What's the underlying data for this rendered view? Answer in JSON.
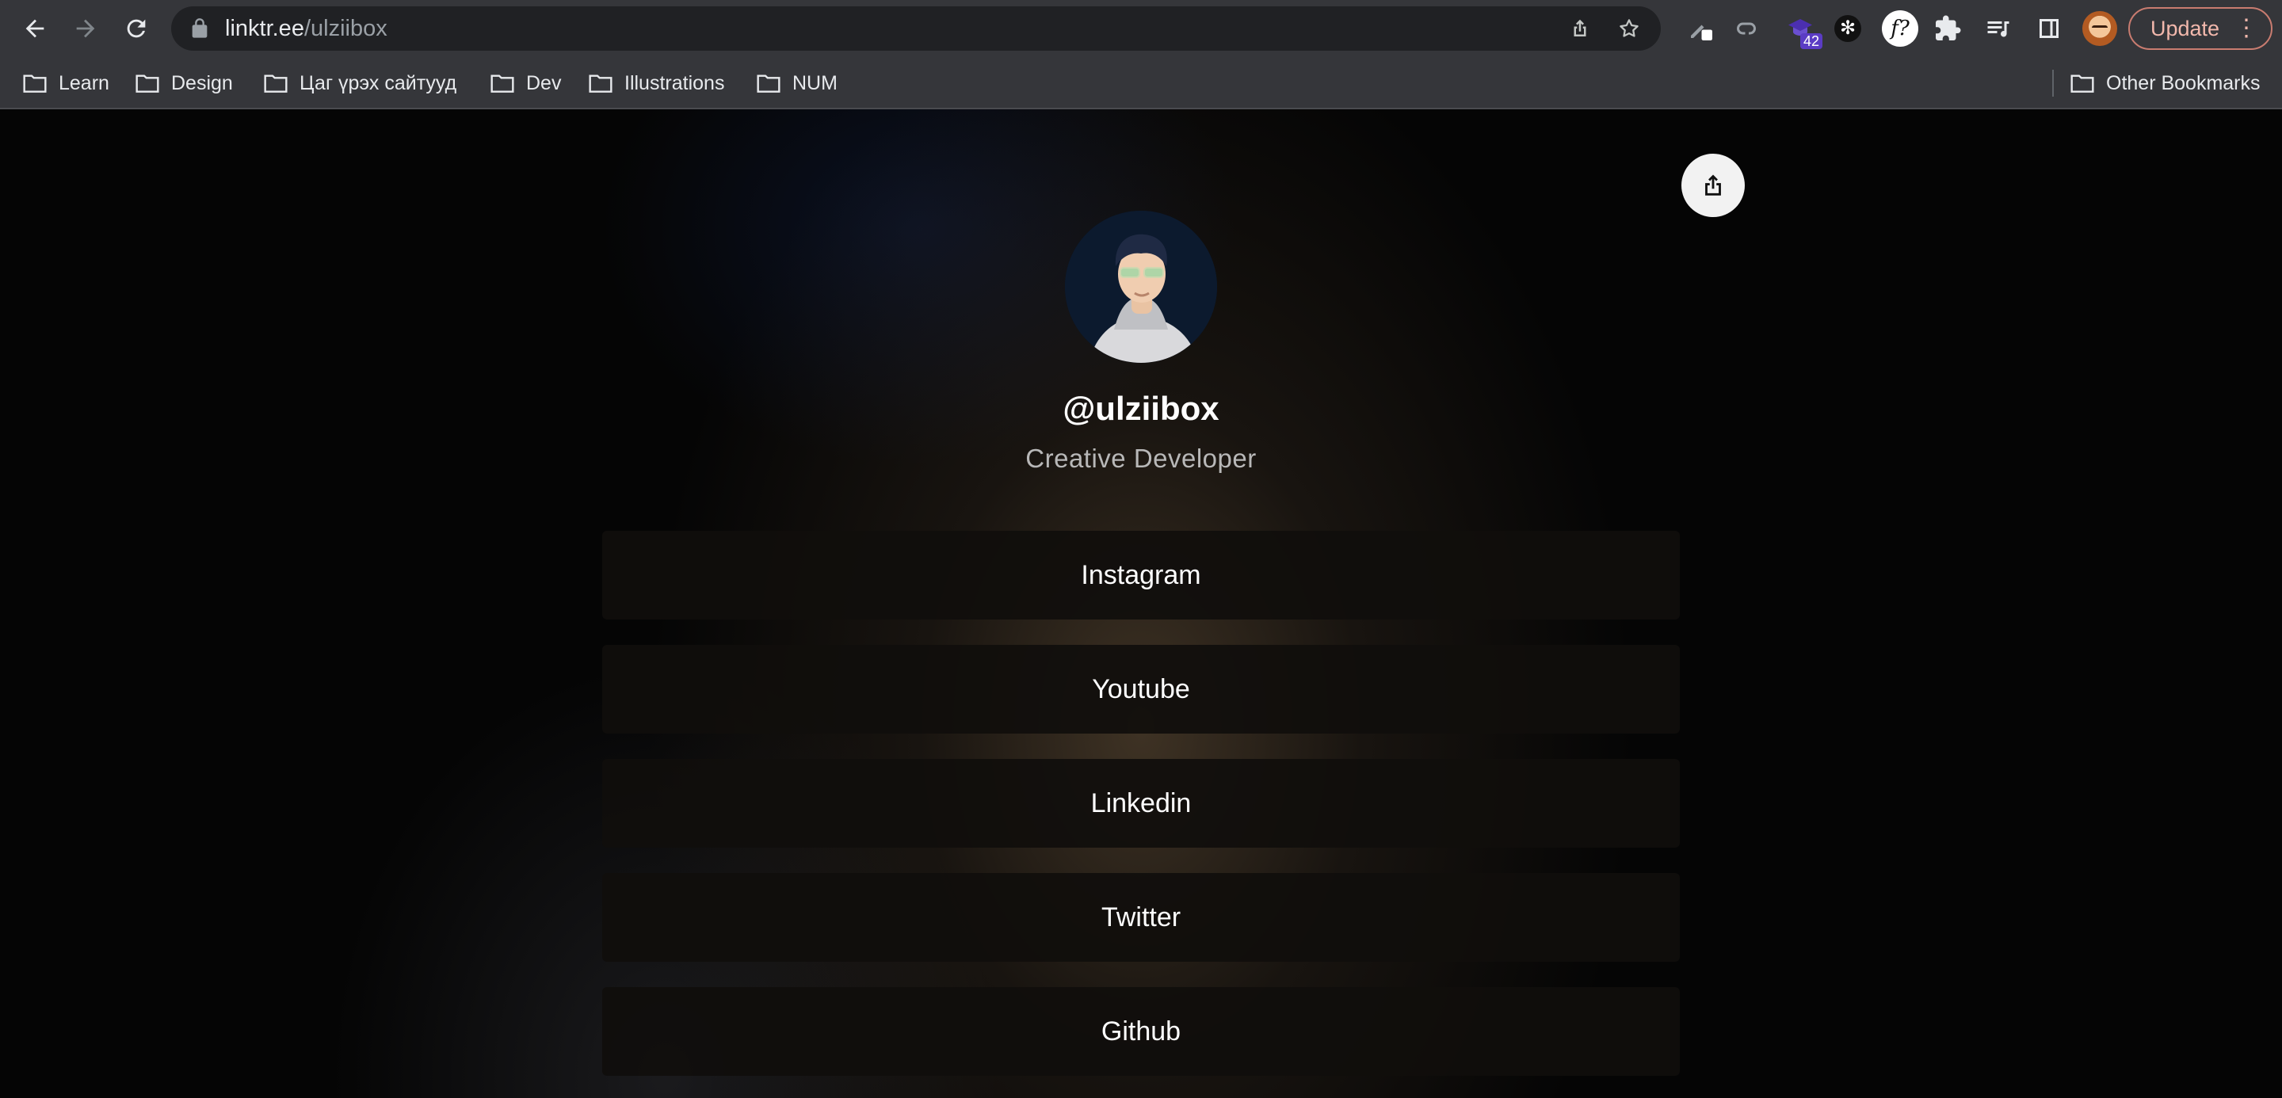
{
  "browser": {
    "url_host": "linktr.ee",
    "url_path": "/ulziibox",
    "extension_badge": "42",
    "update_label": "Update",
    "menu_dots": "⋮",
    "extension_f_label": "f?",
    "extension_asterisk": "✻"
  },
  "bookmarks": {
    "items": [
      {
        "label": "Learn"
      },
      {
        "label": "Design"
      },
      {
        "label": "Цаг үрэх сайтууд"
      },
      {
        "label": "Dev"
      },
      {
        "label": "Illustrations"
      },
      {
        "label": "NUM"
      }
    ],
    "other_label": "Other Bookmarks"
  },
  "profile": {
    "username": "@ulziibox",
    "bio": "Creative Developer"
  },
  "links": [
    {
      "label": "Instagram"
    },
    {
      "label": "Youtube"
    },
    {
      "label": "Linkedin"
    },
    {
      "label": "Twitter"
    },
    {
      "label": "Github"
    }
  ],
  "colors": {
    "toolbar_bg": "#35363a",
    "omnibox_bg": "#202124",
    "page_bg": "#050505",
    "link_button_bg": "#100e0c",
    "update_accent": "#f2b8ac"
  },
  "icons": {
    "back": "arrow-left-icon",
    "forward": "arrow-right-icon",
    "reload": "reload-icon",
    "lock": "lock-icon",
    "share_page": "share-icon",
    "bookmark_star": "star-icon",
    "extensions": "puzzle-icon",
    "reading_list": "reading-list-icon",
    "side_panel": "side-panel-icon",
    "folder": "folder-icon",
    "linktree_share": "share-icon"
  }
}
